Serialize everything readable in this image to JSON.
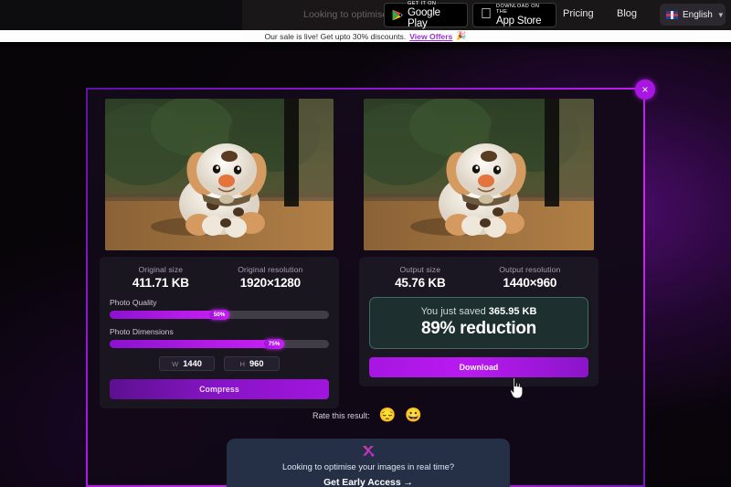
{
  "nav": {
    "tagline": "Looking to optimise your i",
    "google_play": {
      "small": "GET IT ON",
      "big": "Google Play"
    },
    "app_store": {
      "small": "Download on the",
      "big": "App Store"
    },
    "pricing": "Pricing",
    "blog": "Blog",
    "language": "English",
    "chevron": "chevron-down-icon"
  },
  "sale_banner": {
    "text": "Our sale is live! Get upto 30% discounts.",
    "link": "View Offers",
    "emoji": "🎉"
  },
  "modal": {
    "close": "×",
    "left_card": {
      "size_label": "Original size",
      "size_value": "411.71 KB",
      "res_label": "Original resolution",
      "res_value": "1920×1280",
      "quality_label": "Photo Quality",
      "quality_value": "50%",
      "quality_percent": 50,
      "dimensions_label": "Photo Dimensions",
      "dimensions_value": "75%",
      "dimensions_percent": 75,
      "width_key": "W",
      "width_value": "1440",
      "height_key": "H",
      "height_value": "960",
      "button": "Compress"
    },
    "right_card": {
      "size_label": "Output size",
      "size_value": "45.76 KB",
      "res_label": "Output resolution",
      "res_value": "1440×960",
      "saved_prefix": "You just saved ",
      "saved_amount": "365.95 KB",
      "reduction": "89% reduction",
      "button": "Download"
    },
    "rate": {
      "label": "Rate this result:",
      "sad_emoji": "😔",
      "happy_emoji": "😀"
    },
    "promo": {
      "text": "Looking to optimise your images in real time?",
      "cta": "Get Early Access  →"
    }
  },
  "colors": {
    "accent": "#a716e2",
    "accent_bright": "#c81ff5",
    "saved_bg": "#1d2f2f",
    "saved_border": "#3f6b62",
    "promo_bg": "#253047",
    "banner_bg": "#fdfdfd",
    "link": "#9b2fd4"
  }
}
